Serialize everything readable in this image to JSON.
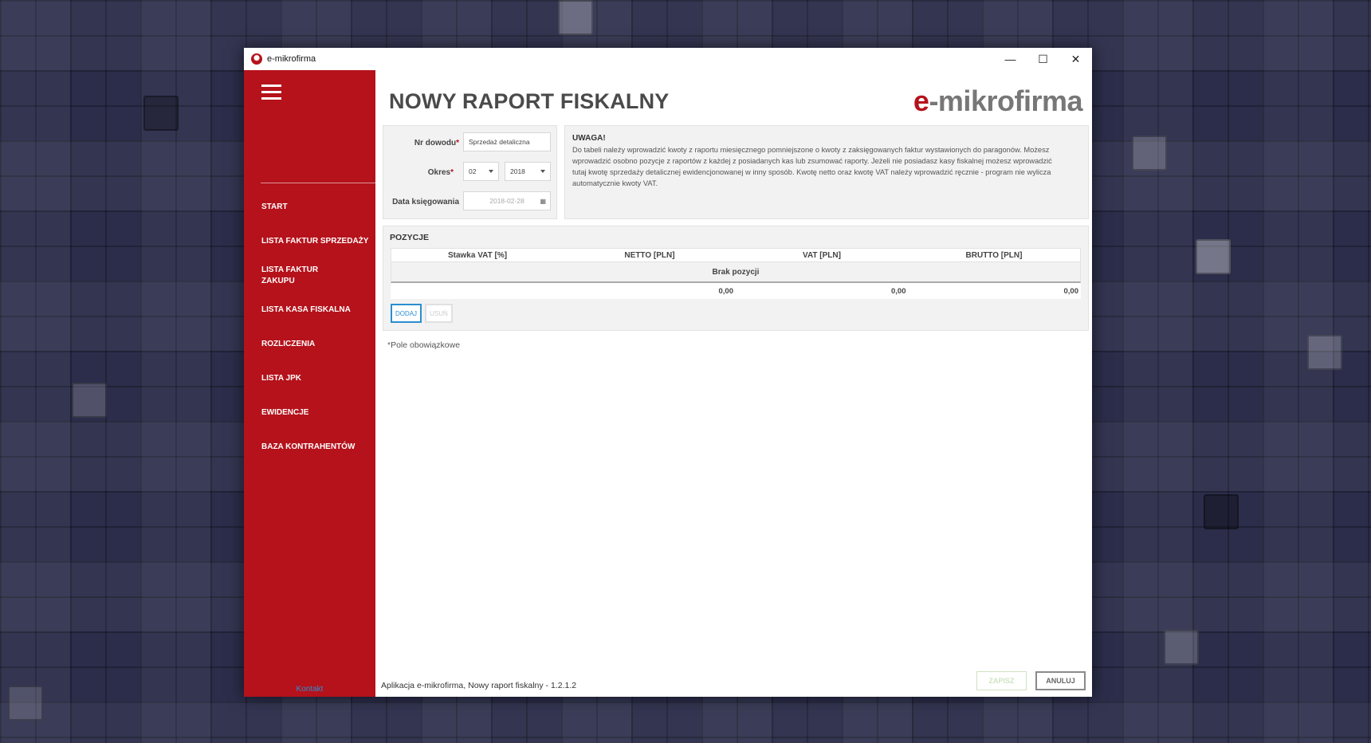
{
  "window": {
    "title": "e-mikrofirma",
    "controls": {
      "minimize": "—",
      "maximize": "☐",
      "close": "✕"
    }
  },
  "sidebar": {
    "items": [
      {
        "label": "START"
      },
      {
        "label": "LISTA FAKTUR SPRZEDAŻY"
      },
      {
        "label": "LISTA FAKTUR ZAKUPU"
      },
      {
        "label": "LISTA KASA FISKALNA"
      },
      {
        "label": "ROZLICZENIA"
      },
      {
        "label": "LISTA JPK"
      },
      {
        "label": "EWIDENCJE"
      },
      {
        "label": "BAZA KONTRAHENTÓW"
      }
    ],
    "contact_label": "Kontakt"
  },
  "header": {
    "title": "NOWY RAPORT FISKALNY",
    "brand_e": "e",
    "brand_rest": "-mikrofirma"
  },
  "form": {
    "nr_dowodu_label": "Nr dowodu",
    "nr_dowodu_value": "Sprzedaż detaliczna",
    "okres_label": "Okres",
    "okres_month": "02",
    "okres_year": "2018",
    "data_label": "Data księgowania",
    "data_value": "2018-02-28",
    "required_mark": "*"
  },
  "notice": {
    "title": "UWAGA!",
    "text": "Do tabeli należy wprowadzić kwoty z raportu miesięcznego pomniejszone o kwoty z zaksięgowanych faktur wystawionych do paragonów. Możesz wprowadzić osobno pozycje z raportów z każdej z posiadanych kas lub zsumować raporty. Jeżeli nie posiadasz kasy fiskalnej możesz wprowadzić tutaj kwotę sprzedaży detalicznej ewidencjonowanej w inny sposób. Kwotę netto oraz kwotę VAT należy wprowadzić ręcznie - program nie wylicza automatycznie kwoty VAT."
  },
  "positions": {
    "title": "POZYCJE",
    "columns": [
      "Stawka VAT [%]",
      "NETTO [PLN]",
      "VAT [PLN]",
      "BRUTTO [PLN]"
    ],
    "empty_text": "Brak pozycji",
    "totals": [
      "",
      "0,00",
      "0,00",
      "0,00"
    ],
    "add_label": "DODAJ",
    "remove_label": "USUŃ"
  },
  "required_note": "Pole obowiązkowe",
  "footer": {
    "status": "Aplikacja e-mikrofirma, Nowy raport fiskalny - 1.2.1.2",
    "save_label": "ZAPISZ",
    "cancel_label": "ANULUJ"
  },
  "colors": {
    "brand_red": "#b5121b",
    "accent_blue": "#2a8fd1"
  }
}
